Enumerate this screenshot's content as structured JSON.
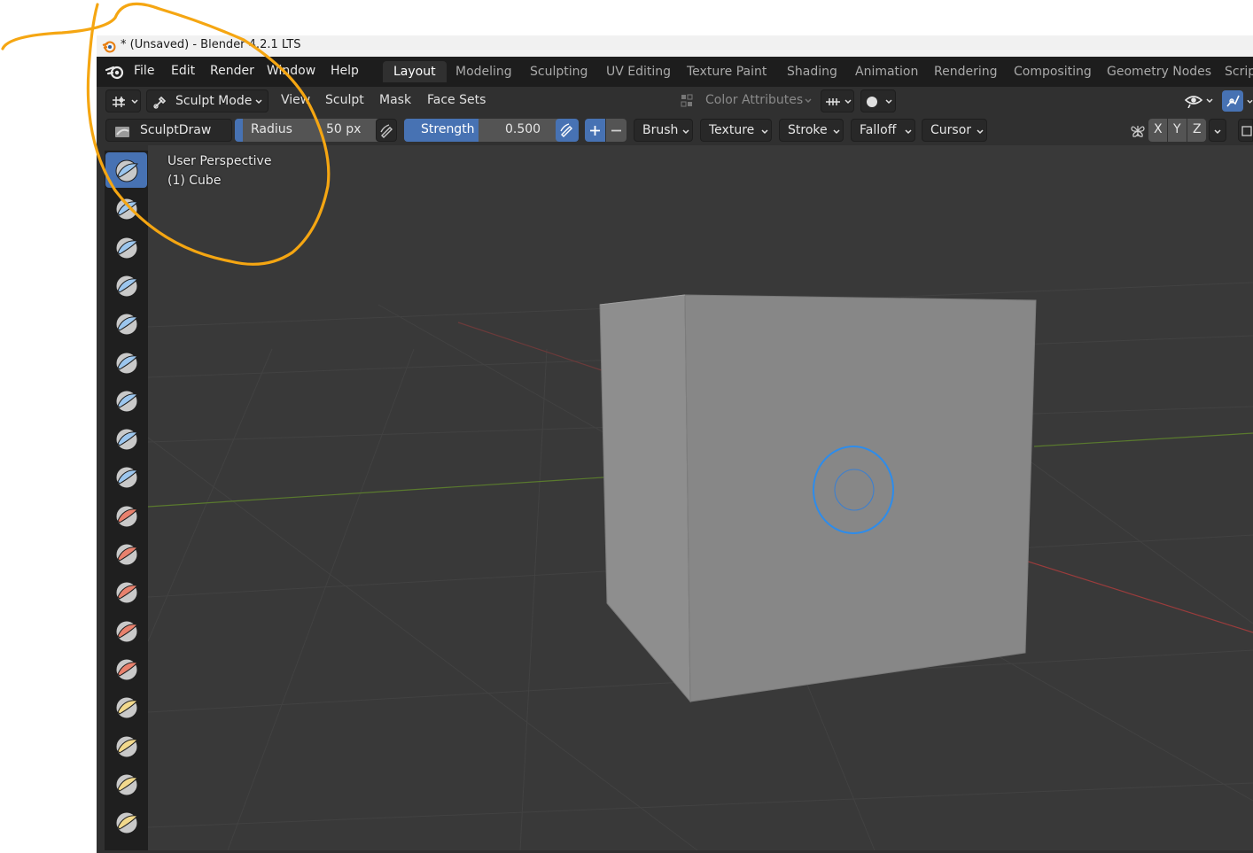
{
  "title_bar": {
    "text": "* (Unsaved) - Blender 4.2.1 LTS"
  },
  "menu": {
    "file": "File",
    "edit": "Edit",
    "render": "Render",
    "window": "Window",
    "help": "Help"
  },
  "workspaces": [
    "Layout",
    "Modeling",
    "Sculpting",
    "UV Editing",
    "Texture Paint",
    "Shading",
    "Animation",
    "Rendering",
    "Compositing",
    "Geometry Nodes",
    "Scripting"
  ],
  "active_workspace": "Layout",
  "header": {
    "mode": "Sculpt Mode",
    "view": "View",
    "sculpt": "Sculpt",
    "mask": "Mask",
    "face_sets": "Face Sets",
    "color_attributes": "Color Attributes"
  },
  "tool_settings": {
    "brush_name": "SculptDraw",
    "radius_label": "Radius",
    "radius_value": "50 px",
    "strength_label": "Strength",
    "strength_value": "0.500",
    "brush": "Brush",
    "texture": "Texture",
    "stroke": "Stroke",
    "falloff": "Falloff",
    "cursor": "Cursor",
    "axis_x": "X",
    "axis_y": "Y",
    "axis_z": "Z"
  },
  "viewport": {
    "perspective": "User Perspective",
    "object": "(1) Cube"
  },
  "colors": {
    "accent": "#4772b3",
    "annotation": "#f5a612",
    "brush_cursor": "#2d8ceb"
  },
  "tools": [
    "sculpt-draw-icon",
    "draw-sharp-icon",
    "clay-icon",
    "clay-strips-icon",
    "clay-thumb-icon",
    "layer-icon",
    "inflate-icon",
    "blob-icon",
    "crease-icon",
    "smooth-icon",
    "flatten-icon",
    "fill-icon",
    "scrape-icon",
    "multiplane-scrape-icon",
    "pinch-icon",
    "grab-icon",
    "elastic-deform-icon",
    "snake-hook-icon"
  ]
}
